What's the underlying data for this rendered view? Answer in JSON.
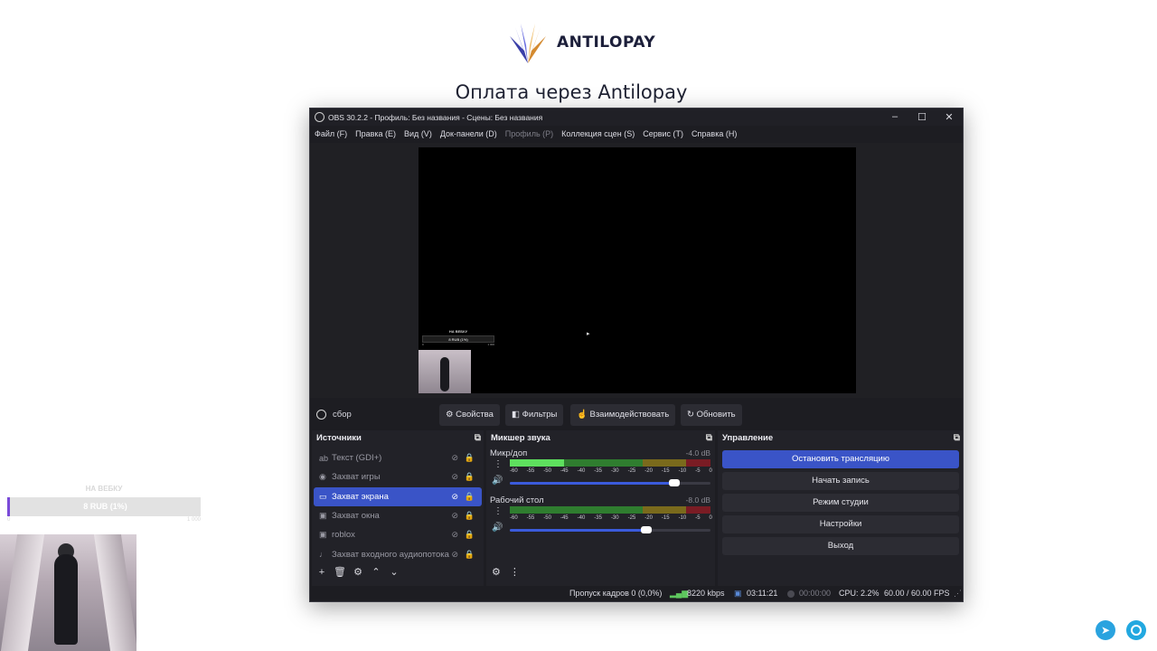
{
  "page": {
    "brand": "ANTILOPAY",
    "title": "Оплата через Antilopay"
  },
  "overlay": {
    "label": "НА ВЕБКУ",
    "bar_text": "8 RUB (1%)",
    "scale_min": "0",
    "scale_max": "1 000",
    "progress_fraction": 0.01
  },
  "obs": {
    "window_title": "OBS 30.2.2 - Профиль: Без названия - Сцены: Без названия",
    "menu": [
      {
        "label": "Файл (F)",
        "disabled": false
      },
      {
        "label": "Правка (E)",
        "disabled": false
      },
      {
        "label": "Вид (V)",
        "disabled": false
      },
      {
        "label": "Док-панели (D)",
        "disabled": false
      },
      {
        "label": "Профиль (P)",
        "disabled": true
      },
      {
        "label": "Коллекция сцен (S)",
        "disabled": false
      },
      {
        "label": "Сервис (T)",
        "disabled": false
      },
      {
        "label": "Справка (H)",
        "disabled": false
      }
    ],
    "preview_widget": {
      "label": "НА ВЕБКУ",
      "bar_text": "8 RUB (1%)",
      "scale_min": "0",
      "scale_max": "1 000"
    },
    "scene_name": "сбор",
    "source_toolbar": {
      "properties": "Свойства",
      "filters": "Фильтры",
      "interact": "Взаимодействовать",
      "refresh": "Обновить"
    },
    "sources": {
      "title": "Источники",
      "items": [
        {
          "icon": "text-icon",
          "glyph": "ab",
          "label": "Текст (GDI+)",
          "active": false
        },
        {
          "icon": "gamepad-icon",
          "glyph": "◉",
          "label": "Захват игры",
          "active": false
        },
        {
          "icon": "monitor-icon",
          "glyph": "▭",
          "label": "Захват экрана",
          "active": true
        },
        {
          "icon": "window-icon",
          "glyph": "▣",
          "label": "Захват окна",
          "active": false
        },
        {
          "icon": "window-icon",
          "glyph": "▣",
          "label": "roblox",
          "active": false
        },
        {
          "icon": "microphone-icon",
          "glyph": "♩",
          "label": "Захват входного аудиопотока",
          "active": false
        }
      ]
    },
    "mixer": {
      "title": "Микшер звука",
      "ticks": [
        "-60",
        "-55",
        "-50",
        "-45",
        "-40",
        "-35",
        "-30",
        "-25",
        "-20",
        "-15",
        "-10",
        "-5",
        "0"
      ],
      "channels": [
        {
          "name": "Микр/доп",
          "db": "-4.0 dB",
          "level": 0.27,
          "volume": 0.82
        },
        {
          "name": "Рабочий стол",
          "db": "-8.0 dB",
          "level": 0.0,
          "volume": 0.68
        }
      ]
    },
    "controls": {
      "title": "Управление",
      "stop_stream": "Остановить трансляцию",
      "start_record": "Начать запись",
      "studio_mode": "Режим студии",
      "settings": "Настройки",
      "exit": "Выход"
    },
    "status": {
      "dropped": "Пропуск кадров 0 (0,0%)",
      "bitrate": "8220 kbps",
      "stream_time": "03:11:21",
      "rec_time": "00:00:00",
      "cpu": "CPU: 2.2%",
      "fps": "60.00 / 60.00 FPS"
    }
  },
  "colors": {
    "accent": "#3a54c7",
    "window_bg": "#1d1d22",
    "telegram": "#2aa3df"
  }
}
